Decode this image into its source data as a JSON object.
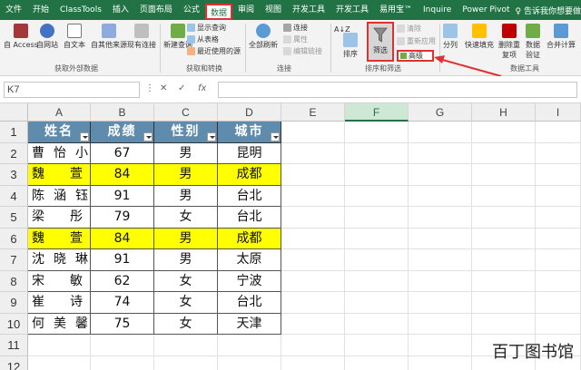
{
  "ribbon_tabs": [
    "文件",
    "开始",
    "ClassTools",
    "插入",
    "页面布局",
    "公式",
    "数据",
    "审阅",
    "视图",
    "开发工具",
    "开发工具",
    "易用宝™",
    "Inquire",
    "Power Pivot"
  ],
  "active_tab": "数据",
  "tell_me": "♀ 告诉我你想要做什么",
  "ribbon": {
    "access": "自 Access",
    "web": "自网站",
    "text": "自文本",
    "other": "自其他来源",
    "existing": "现有连接",
    "group_external": "获取外部数据",
    "new_query": "新建查询",
    "show_query": "显示查询",
    "from_table": "从表格",
    "recent_sources": "最近使用的源",
    "group_transform": "获取和转换",
    "refresh_all": "全部刷新",
    "connections": "连接",
    "properties": "属性",
    "edit_links": "编辑链接",
    "group_conn": "连接",
    "sort_az": "A↓Z",
    "sort": "排序",
    "filter": "筛选",
    "clear": "清除",
    "reapply": "重新应用",
    "advanced": "高级",
    "group_sort": "排序和筛选",
    "split": "分列",
    "flash_fill": "快速填充",
    "remove_dup": "删除重复项",
    "validation": "数据验证",
    "consolidate": "合并计算",
    "group_tools": "数据工具"
  },
  "namebox": "K7",
  "fx": "fx",
  "columns": [
    "A",
    "B",
    "C",
    "D",
    "E",
    "F",
    "G",
    "H",
    "I"
  ],
  "selected_column": "F",
  "rows": [
    "1",
    "2",
    "3",
    "4",
    "5",
    "6",
    "7",
    "8",
    "9",
    "10",
    "11",
    "12"
  ],
  "table": {
    "headers": [
      "姓名",
      "成绩",
      "性别",
      "城市"
    ],
    "rows": [
      {
        "name": "曹怡小",
        "score": "67",
        "gender": "男",
        "city": "昆明",
        "yellow": false
      },
      {
        "name": "魏萱",
        "score": "84",
        "gender": "男",
        "city": "成都",
        "yellow": true
      },
      {
        "name": "陈涵钰",
        "score": "91",
        "gender": "男",
        "city": "台北",
        "yellow": false
      },
      {
        "name": "梁彤",
        "score": "79",
        "gender": "女",
        "city": "台北",
        "yellow": false
      },
      {
        "name": "魏萱",
        "score": "84",
        "gender": "男",
        "city": "成都",
        "yellow": true
      },
      {
        "name": "沈晓琳",
        "score": "91",
        "gender": "男",
        "city": "太原",
        "yellow": false
      },
      {
        "name": "宋敏",
        "score": "62",
        "gender": "女",
        "city": "宁波",
        "yellow": false
      },
      {
        "name": "崔诗",
        "score": "74",
        "gender": "女",
        "city": "台北",
        "yellow": false
      },
      {
        "name": "何美馨",
        "score": "75",
        "gender": "女",
        "city": "天津",
        "yellow": false
      }
    ]
  },
  "watermark": "百丁图书馆",
  "colors": {
    "ribbon_green": "#217346",
    "header_fill": "#5f8cac",
    "highlight": "#ffff00",
    "annotation_red": "#e03030"
  }
}
